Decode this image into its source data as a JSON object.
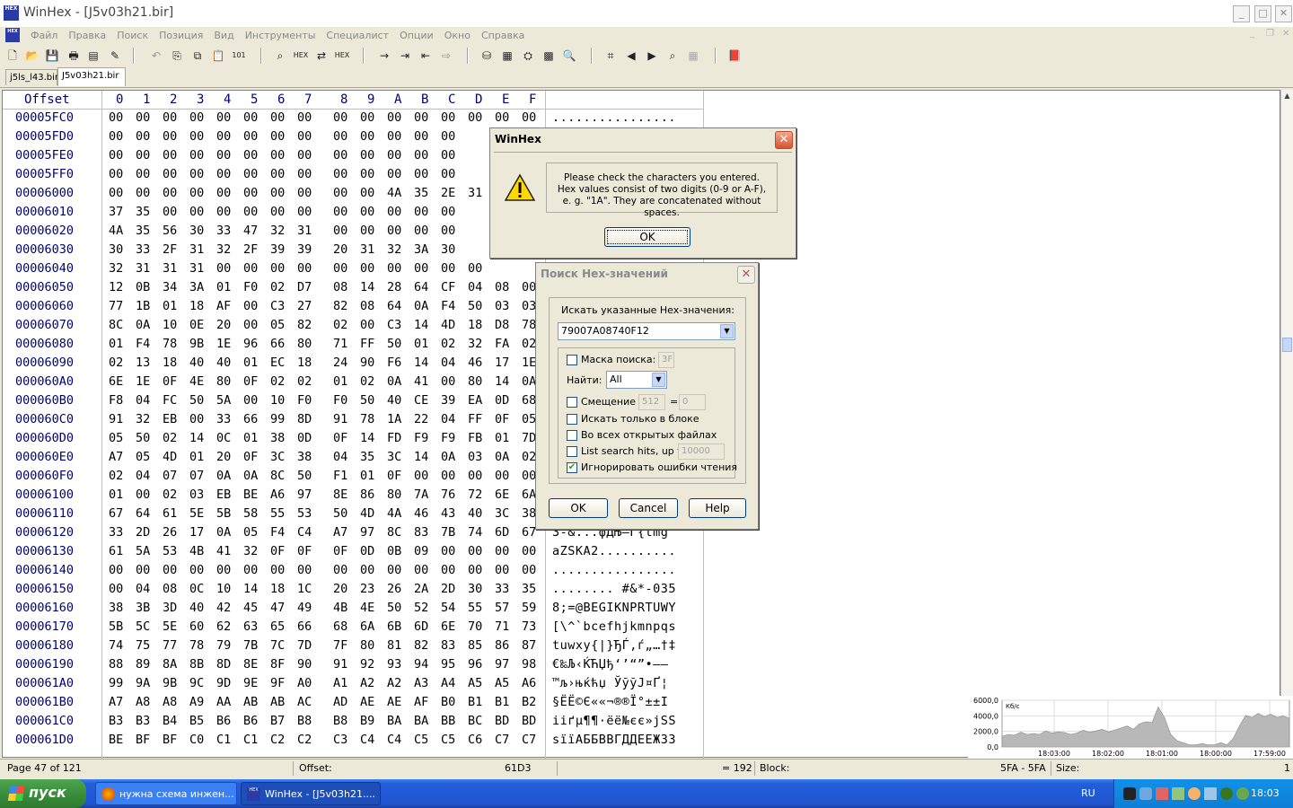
{
  "window": {
    "title": "WinHex - [J5v03h21.bir]",
    "app_icon": "HEX"
  },
  "menu": [
    "Файл",
    "Правка",
    "Поиск",
    "Позиция",
    "Вид",
    "Инструменты",
    "Специалист",
    "Опции",
    "Окно",
    "Справка"
  ],
  "tabs": [
    {
      "label": "j5ls_l43.bir"
    },
    {
      "label": "J5v03h21.bir"
    }
  ],
  "hex": {
    "offset_header": "Offset",
    "columns": [
      "0",
      "1",
      "2",
      "3",
      "4",
      "5",
      "6",
      "7",
      "8",
      "9",
      "A",
      "B",
      "C",
      "D",
      "E",
      "F"
    ],
    "rows": [
      {
        "offset": "00005FC0",
        "bytes": [
          "00",
          "00",
          "00",
          "00",
          "00",
          "00",
          "00",
          "00",
          "00",
          "00",
          "00",
          "00",
          "00",
          "00",
          "00",
          "00"
        ],
        "text": "................"
      },
      {
        "offset": "00005FD0",
        "bytes": [
          "00",
          "00",
          "00",
          "00",
          "00",
          "00",
          "00",
          "00",
          "00",
          "00",
          "00",
          "00",
          "00",
          "",
          "",
          ""
        ],
        "text": ""
      },
      {
        "offset": "00005FE0",
        "bytes": [
          "00",
          "00",
          "00",
          "00",
          "00",
          "00",
          "00",
          "00",
          "00",
          "00",
          "00",
          "00",
          "00",
          "",
          "",
          ""
        ],
        "text": ""
      },
      {
        "offset": "00005FF0",
        "bytes": [
          "00",
          "00",
          "00",
          "00",
          "00",
          "00",
          "00",
          "00",
          "00",
          "00",
          "00",
          "00",
          "00",
          "",
          "",
          ""
        ],
        "text": ""
      },
      {
        "offset": "00006000",
        "bytes": [
          "00",
          "00",
          "00",
          "00",
          "00",
          "00",
          "00",
          "00",
          "00",
          "00",
          "4A",
          "35",
          "2E",
          "31",
          "",
          ""
        ],
        "text": ""
      },
      {
        "offset": "00006010",
        "bytes": [
          "37",
          "35",
          "00",
          "00",
          "00",
          "00",
          "00",
          "00",
          "00",
          "00",
          "00",
          "00",
          "00",
          "",
          "",
          ""
        ],
        "text": ""
      },
      {
        "offset": "00006020",
        "bytes": [
          "4A",
          "35",
          "56",
          "30",
          "33",
          "47",
          "32",
          "31",
          "00",
          "00",
          "00",
          "00",
          "00",
          "",
          "",
          ""
        ],
        "text": ""
      },
      {
        "offset": "00006030",
        "bytes": [
          "30",
          "33",
          "2F",
          "31",
          "32",
          "2F",
          "39",
          "39",
          "20",
          "31",
          "32",
          "3A",
          "30",
          "",
          "",
          ""
        ],
        "text": ""
      },
      {
        "offset": "00006040",
        "bytes": [
          "32",
          "31",
          "31",
          "31",
          "00",
          "00",
          "00",
          "00",
          "00",
          "00",
          "00",
          "00",
          "00",
          "00",
          "",
          ""
        ],
        "text": ""
      },
      {
        "offset": "00006050",
        "bytes": [
          "12",
          "0B",
          "34",
          "3A",
          "01",
          "F0",
          "02",
          "D7",
          "08",
          "14",
          "28",
          "64",
          "CF",
          "04",
          "08",
          "00"
        ],
        "text": ""
      },
      {
        "offset": "00006060",
        "bytes": [
          "77",
          "1B",
          "01",
          "18",
          "AF",
          "00",
          "C3",
          "27",
          "82",
          "08",
          "64",
          "0A",
          "F4",
          "50",
          "03",
          "03"
        ],
        "text": ""
      },
      {
        "offset": "00006070",
        "bytes": [
          "8C",
          "0A",
          "10",
          "0E",
          "20",
          "00",
          "05",
          "82",
          "02",
          "00",
          "C3",
          "14",
          "4D",
          "18",
          "D8",
          "78"
        ],
        "text": ""
      },
      {
        "offset": "00006080",
        "bytes": [
          "01",
          "F4",
          "78",
          "9B",
          "1E",
          "96",
          "66",
          "80",
          "71",
          "FF",
          "50",
          "01",
          "02",
          "32",
          "FA",
          "02"
        ],
        "text": ""
      },
      {
        "offset": "00006090",
        "bytes": [
          "02",
          "13",
          "18",
          "40",
          "40",
          "01",
          "EC",
          "18",
          "24",
          "90",
          "F6",
          "14",
          "04",
          "46",
          "17",
          "1E"
        ],
        "text": ""
      },
      {
        "offset": "000060A0",
        "bytes": [
          "6E",
          "1E",
          "0F",
          "4E",
          "80",
          "0F",
          "02",
          "02",
          "01",
          "02",
          "0A",
          "41",
          "00",
          "80",
          "14",
          "0A"
        ],
        "text": ""
      },
      {
        "offset": "000060B0",
        "bytes": [
          "F8",
          "04",
          "FC",
          "50",
          "5A",
          "00",
          "10",
          "F0",
          "F0",
          "50",
          "40",
          "CE",
          "39",
          "EA",
          "0D",
          "68"
        ],
        "text": ""
      },
      {
        "offset": "000060C0",
        "bytes": [
          "91",
          "32",
          "EB",
          "00",
          "33",
          "66",
          "99",
          "8D",
          "91",
          "78",
          "1A",
          "22",
          "04",
          "FF",
          "0F",
          "05"
        ],
        "text": ""
      },
      {
        "offset": "000060D0",
        "bytes": [
          "05",
          "50",
          "02",
          "14",
          "0C",
          "01",
          "38",
          "0D",
          "0F",
          "14",
          "FD",
          "F9",
          "F9",
          "FB",
          "01",
          "7D"
        ],
        "text": ""
      },
      {
        "offset": "000060E0",
        "bytes": [
          "A7",
          "05",
          "4D",
          "01",
          "20",
          "0F",
          "3C",
          "38",
          "04",
          "35",
          "3C",
          "14",
          "0A",
          "03",
          "0A",
          "02"
        ],
        "text": ""
      },
      {
        "offset": "000060F0",
        "bytes": [
          "02",
          "04",
          "07",
          "07",
          "0A",
          "0A",
          "8C",
          "50",
          "F1",
          "01",
          "0F",
          "00",
          "00",
          "00",
          "00",
          "00"
        ],
        "text": ""
      },
      {
        "offset": "00006100",
        "bytes": [
          "01",
          "00",
          "02",
          "03",
          "EB",
          "BE",
          "A6",
          "97",
          "8E",
          "86",
          "80",
          "7A",
          "76",
          "72",
          "6E",
          "6A"
        ],
        "text": ""
      },
      {
        "offset": "00006110",
        "bytes": [
          "67",
          "64",
          "61",
          "5E",
          "5B",
          "58",
          "55",
          "53",
          "50",
          "4D",
          "4A",
          "46",
          "43",
          "40",
          "3C",
          "38"
        ],
        "text": ""
      },
      {
        "offset": "00006120",
        "bytes": [
          "33",
          "2D",
          "26",
          "17",
          "0A",
          "05",
          "F4",
          "C4",
          "A7",
          "97",
          "8C",
          "83",
          "7B",
          "74",
          "6D",
          "67"
        ],
        "text": "3-&...фДЊ—Ѓ{tmg"
      },
      {
        "offset": "00006130",
        "bytes": [
          "61",
          "5A",
          "53",
          "4B",
          "41",
          "32",
          "0F",
          "0F",
          "0F",
          "0D",
          "0B",
          "09",
          "00",
          "00",
          "00",
          "00"
        ],
        "text": "aZSKA2.........."
      },
      {
        "offset": "00006140",
        "bytes": [
          "00",
          "00",
          "00",
          "00",
          "00",
          "00",
          "00",
          "00",
          "00",
          "00",
          "00",
          "00",
          "00",
          "00",
          "00",
          "00"
        ],
        "text": "................"
      },
      {
        "offset": "00006150",
        "bytes": [
          "00",
          "04",
          "08",
          "0C",
          "10",
          "14",
          "18",
          "1C",
          "20",
          "23",
          "26",
          "2A",
          "2D",
          "30",
          "33",
          "35"
        ],
        "text": "........ #&*-035"
      },
      {
        "offset": "00006160",
        "bytes": [
          "38",
          "3B",
          "3D",
          "40",
          "42",
          "45",
          "47",
          "49",
          "4B",
          "4E",
          "50",
          "52",
          "54",
          "55",
          "57",
          "59"
        ],
        "text": "8;=@BEGIKNPRTUWY"
      },
      {
        "offset": "00006170",
        "bytes": [
          "5B",
          "5C",
          "5E",
          "60",
          "62",
          "63",
          "65",
          "66",
          "68",
          "6A",
          "6B",
          "6D",
          "6E",
          "70",
          "71",
          "73"
        ],
        "text": "[\\^`bcefhjkmnpqs"
      },
      {
        "offset": "00006180",
        "bytes": [
          "74",
          "75",
          "77",
          "78",
          "79",
          "7B",
          "7C",
          "7D",
          "7F",
          "80",
          "81",
          "82",
          "83",
          "85",
          "86",
          "87"
        ],
        "text": "tuwxy{|}ЂЃ‚ѓ„…†‡"
      },
      {
        "offset": "00006190",
        "bytes": [
          "88",
          "89",
          "8A",
          "8B",
          "8D",
          "8E",
          "8F",
          "90",
          "91",
          "92",
          "93",
          "94",
          "95",
          "96",
          "97",
          "98"
        ],
        "text": "€‰Љ‹ЌЋЏђ‘’“”•–—"
      },
      {
        "offset": "000061A0",
        "bytes": [
          "99",
          "9A",
          "9B",
          "9C",
          "9D",
          "9E",
          "9F",
          "A0",
          "A1",
          "A2",
          "A2",
          "A3",
          "A4",
          "A5",
          "A5",
          "A6"
        ],
        "text": "™љ›њќћџ ЎўўЈ¤Ґ¦"
      },
      {
        "offset": "000061B0",
        "bytes": [
          "A7",
          "A8",
          "A8",
          "A9",
          "AA",
          "AB",
          "AB",
          "AC",
          "AD",
          "AE",
          "AE",
          "AF",
          "B0",
          "B1",
          "B1",
          "B2"
        ],
        "text": "§ЁЁ©Є««¬­®®Ї°±±І"
      },
      {
        "offset": "000061C0",
        "bytes": [
          "B3",
          "B3",
          "B4",
          "B5",
          "B6",
          "B6",
          "B7",
          "B8",
          "B8",
          "B9",
          "BA",
          "BA",
          "BB",
          "BC",
          "BD",
          "BD"
        ],
        "text": "ііґµ¶¶·ёё№єє»јЅЅ"
      },
      {
        "offset": "000061D0",
        "bytes": [
          "BE",
          "BF",
          "BF",
          "C0",
          "C1",
          "C1",
          "C2",
          "C2",
          "C3",
          "C4",
          "C4",
          "C5",
          "C5",
          "C6",
          "C7",
          "C7"
        ],
        "text": "sїїАББВВГДДЕЕЖЗЗ"
      }
    ]
  },
  "graph": {
    "y_ticks": [
      "6000,0",
      "4000,0",
      "2000,0",
      "0,0"
    ],
    "unit": "Кб/с",
    "x_ticks": [
      "18:03:00",
      "18:02:00",
      "18:01:00",
      "18:00:00",
      "17:59:00"
    ],
    "values": [
      0.25,
      0.3,
      0.28,
      0.35,
      0.3,
      0.32,
      0.3,
      0.38,
      0.33,
      0.36,
      0.34,
      0.3,
      0.33,
      0.4,
      0.35,
      0.38,
      0.42,
      0.36,
      0.4,
      0.45,
      0.5,
      0.42,
      0.55,
      0.6,
      0.58,
      0.95,
      0.7,
      0.3,
      0.15,
      0.1,
      0.05,
      0.05,
      0.08,
      0.05,
      0.05,
      0.1,
      0.05,
      0.2,
      0.5,
      0.75,
      0.7,
      0.8,
      0.72,
      0.78,
      0.7,
      0.74,
      0.68
    ]
  },
  "status": {
    "page": "Page 47 of 121",
    "offset_label": "Offset:",
    "offset_value": "61D3",
    "value": "= 192",
    "block_label": "Block:",
    "block_value": "5FA - 5FA",
    "size_label": "Size:",
    "size_value": "1"
  },
  "alert": {
    "title": "WinHex",
    "message": "Please check the characters you entered. Hex values consist of two digits (0-9 or A-F), e. g. \"1A\". They are concatenated without spaces.",
    "ok": "OK"
  },
  "search": {
    "title": "Поиск Hex-значений",
    "prompt": "Искать указанные Hex-значения:",
    "value": "79007A08740F12",
    "mask_label": "Маска поиска:",
    "mask_value": "3F",
    "mask_checked": false,
    "find_label": "Найти:",
    "find_value": "All",
    "offset_label": "Смещение",
    "offset_value": "512",
    "offset_eq": "=",
    "offset_rem": "0",
    "offset_checked": false,
    "block_only_label": "Искать только в блоке",
    "block_only_checked": false,
    "all_files_label": "Во всех открытых файлах",
    "all_files_checked": false,
    "list_hits_label": "List search hits, up to",
    "list_hits_value": "10000",
    "list_hits_checked": false,
    "ignore_errors_label": "Игнорировать ошибки чтения",
    "ignore_errors_checked": true,
    "ok": "OK",
    "cancel": "Cancel",
    "help": "Help"
  },
  "taskbar": {
    "start": "пуск",
    "tasks": [
      {
        "label": "нужна схема инжен...",
        "icon": "firefox-icon"
      },
      {
        "label": "WinHex - [J5v03h21....",
        "icon": "winhex-icon"
      }
    ],
    "lang": "RU",
    "clock": "18:03"
  }
}
